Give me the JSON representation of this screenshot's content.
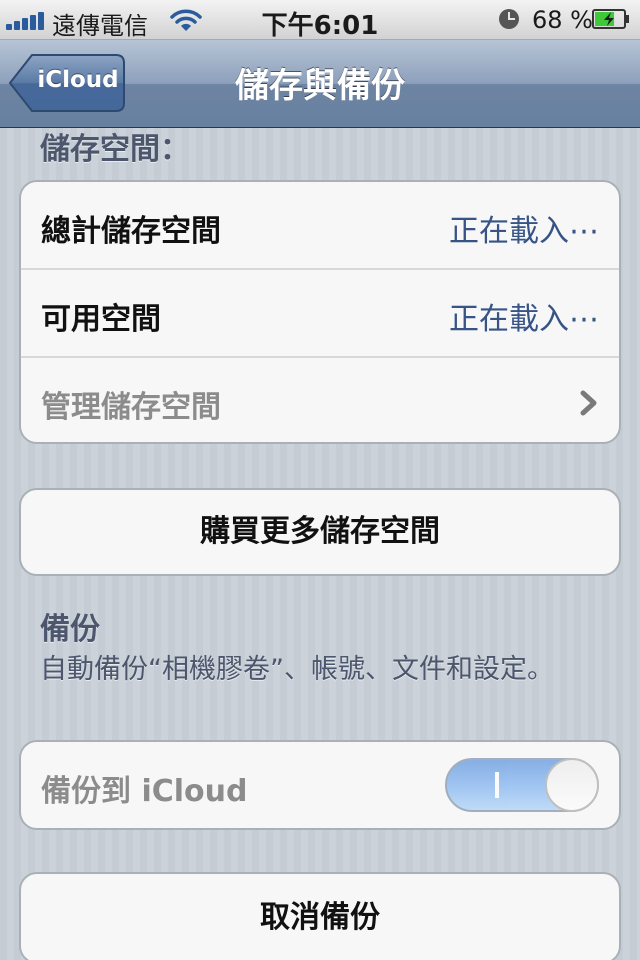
{
  "status_bar": {
    "carrier": "遠傳電信",
    "time": "下午6:01",
    "battery_percent": "68 %",
    "battery_level": 0.68,
    "icons": [
      "signal-bars-icon",
      "wifi-icon",
      "alarm-clock-icon",
      "battery-charging-icon"
    ]
  },
  "nav": {
    "back_label": "iCloud",
    "title": "儲存與備份"
  },
  "storage": {
    "header": "儲存空間：",
    "rows": [
      {
        "label": "總計儲存空間",
        "value": "正在載入⋯"
      },
      {
        "label": "可用空間",
        "value": "正在載入⋯"
      },
      {
        "label": "管理儲存空間"
      }
    ]
  },
  "buy_button": {
    "label": "購買更多儲存空間"
  },
  "backup": {
    "header": "備份",
    "description": "自動備份“相機膠卷”、帳號、文件和設定。",
    "toggle_label": "備份到 iCloud",
    "toggle_on": true,
    "cancel_label": "取消備份"
  },
  "colors": {
    "background": "#c5ccd4",
    "nav_bar": "#6d84a2",
    "value_text": "#385487",
    "toggle_on": "#3d7fd9"
  }
}
